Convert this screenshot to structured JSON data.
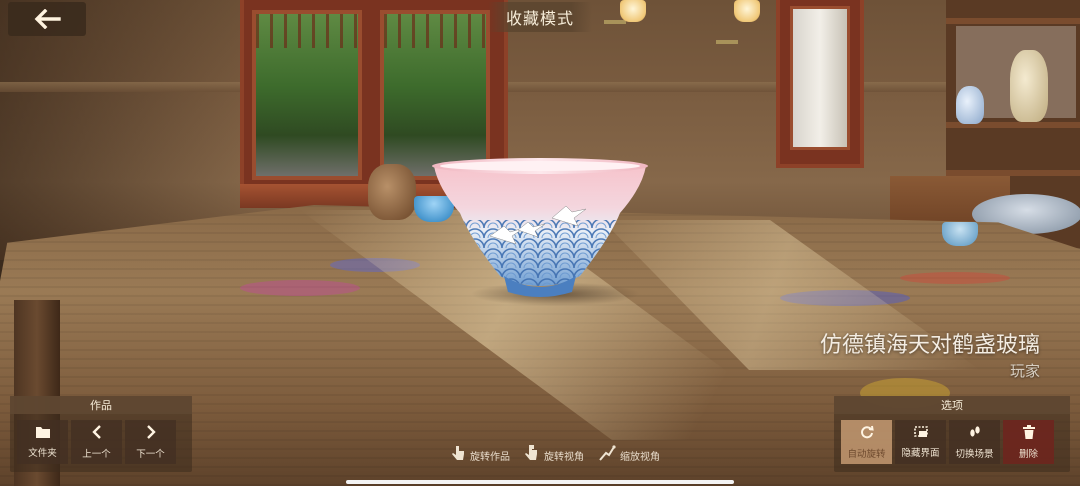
{
  "header": {
    "back_icon": "arrow-left-icon",
    "mode_title": "收藏模式"
  },
  "artwork": {
    "name": "仿德镇海天对鹤盏玻璃",
    "author": "玩家"
  },
  "works_panel": {
    "title": "作品",
    "buttons": [
      {
        "label": "文件夹",
        "icon": "folder-icon",
        "glyph": "■"
      },
      {
        "label": "上一个",
        "icon": "chevron-left-icon",
        "glyph": "‹"
      },
      {
        "label": "下一个",
        "icon": "chevron-right-icon",
        "glyph": "›"
      }
    ]
  },
  "options_panel": {
    "title": "选项",
    "buttons": [
      {
        "label": "自动旋转",
        "icon": "rotate-icon",
        "glyph": "⟳",
        "active": true
      },
      {
        "label": "隐藏界面",
        "icon": "hide-ui-icon",
        "glyph": "▣"
      },
      {
        "label": "切换场景",
        "icon": "footprint-icon",
        "glyph": "✥"
      },
      {
        "label": "删除",
        "icon": "trash-icon",
        "glyph": "🗑",
        "danger": true
      }
    ]
  },
  "gesture_hints": [
    {
      "label": "旋转作品",
      "icon": "one-finger-drag-icon",
      "glyph": "☝"
    },
    {
      "label": "旋转视角",
      "icon": "two-finger-drag-icon",
      "glyph": "☝"
    },
    {
      "label": "缩放视角",
      "icon": "pinch-icon",
      "glyph": "✌"
    }
  ],
  "colors": {
    "panel_title_bg": "#604832",
    "active_button": "#c49a72",
    "danger_button": "#6e241e",
    "text": "#f6ecd8"
  }
}
